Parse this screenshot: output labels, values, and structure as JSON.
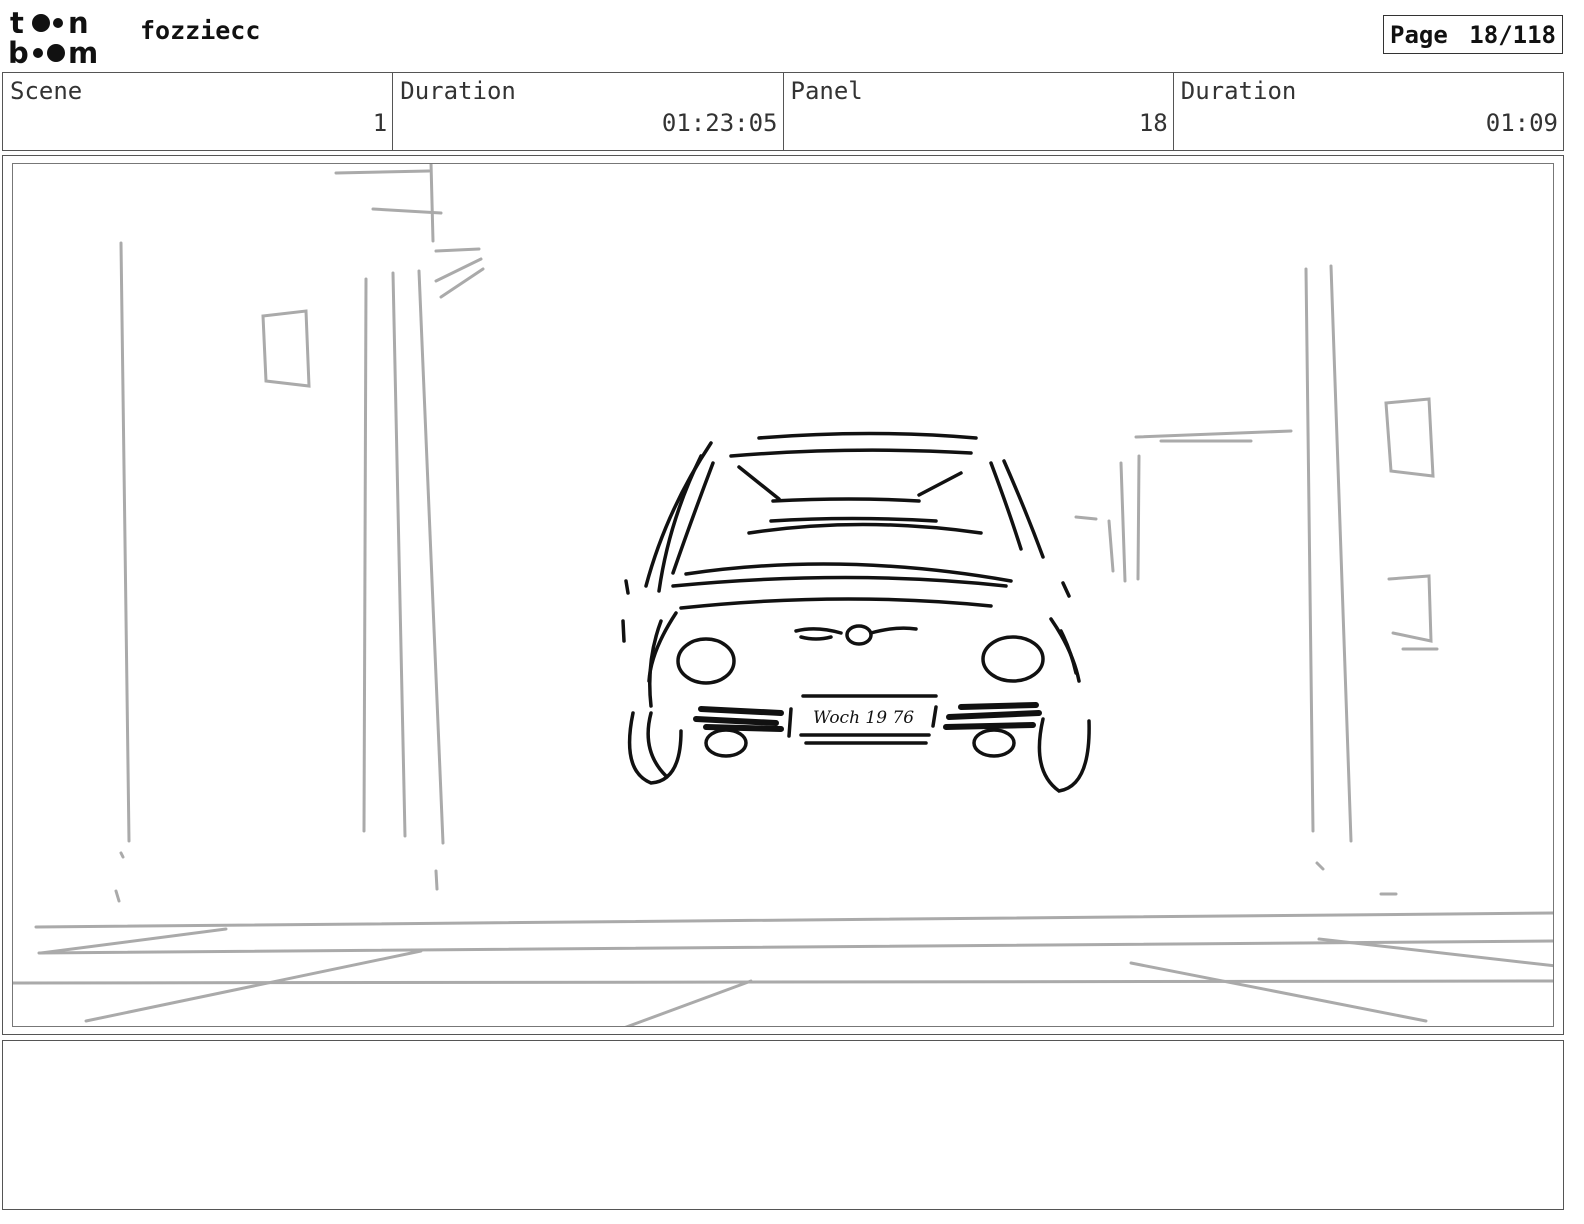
{
  "header": {
    "logo_text": [
      "to",
      "n",
      "b",
      "m"
    ],
    "project_name": "fozziecc",
    "page_label": "Page",
    "page_value": "18/118"
  },
  "info": {
    "scene_label": "Scene",
    "scene_value": "1",
    "scene_duration_label": "Duration",
    "scene_duration_value": "01:23:05",
    "panel_label": "Panel",
    "panel_value": "18",
    "panel_duration_label": "Duration",
    "panel_duration_value": "01:09"
  },
  "panel": {
    "license_plate": "Woch 19 76"
  },
  "notes": {
    "text": ""
  }
}
